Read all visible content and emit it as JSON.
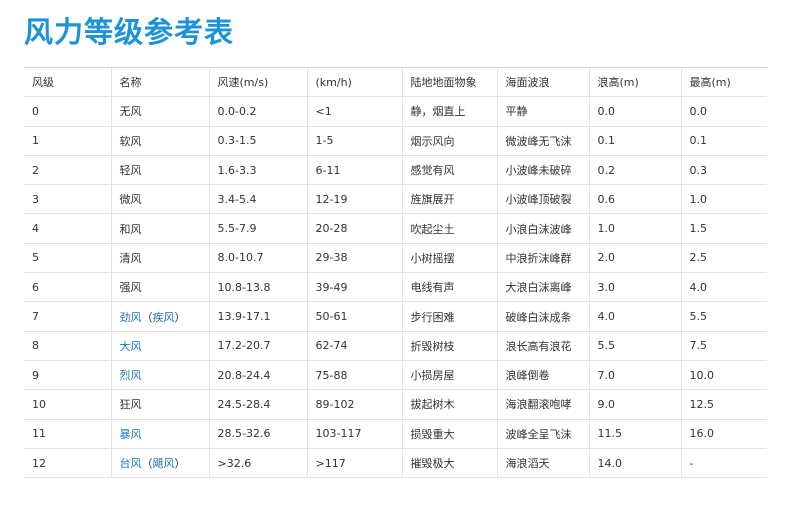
{
  "title": "风力等级参考表",
  "headers": [
    "风级",
    "名称",
    "风速(m/s)",
    "(km/h)",
    "陆地地面物象",
    "海面波浪",
    "浪高(m)",
    "最高(m)"
  ],
  "rows": [
    {
      "level": "0",
      "name": "无风",
      "alt": "",
      "ms": "0.0-0.2",
      "kmh": "<1",
      "land": "静，烟直上",
      "sea": "平静",
      "wave": "0.0",
      "max": "0.0"
    },
    {
      "level": "1",
      "name": "软风",
      "alt": "",
      "ms": "0.3-1.5",
      "kmh": "1-5",
      "land": "烟示风向",
      "sea": "微波峰无飞沫",
      "wave": "0.1",
      "max": "0.1"
    },
    {
      "level": "2",
      "name": "轻风",
      "alt": "",
      "ms": "1.6-3.3",
      "kmh": "6-11",
      "land": "感觉有风",
      "sea": "小波峰未破碎",
      "wave": "0.2",
      "max": "0.3"
    },
    {
      "level": "3",
      "name": "微风",
      "alt": "",
      "ms": "3.4-5.4",
      "kmh": "12-19",
      "land": "旌旗展开",
      "sea": "小波峰顶破裂",
      "wave": "0.6",
      "max": "1.0"
    },
    {
      "level": "4",
      "name": "和风",
      "alt": "",
      "ms": "5.5-7.9",
      "kmh": "20-28",
      "land": "吹起尘土",
      "sea": "小浪白沫波峰",
      "wave": "1.0",
      "max": "1.5"
    },
    {
      "level": "5",
      "name": "清风",
      "alt": "",
      "ms": "8.0-10.7",
      "kmh": "29-38",
      "land": "小树摇摆",
      "sea": "中浪折沫峰群",
      "wave": "2.0",
      "max": "2.5"
    },
    {
      "level": "6",
      "name": "强风",
      "alt": "",
      "ms": "10.8-13.8",
      "kmh": "39-49",
      "land": "电线有声",
      "sea": "大浪白沫离峰",
      "wave": "3.0",
      "max": "4.0"
    },
    {
      "level": "7",
      "name": "劲风",
      "alt": "疾风",
      "ms": "13.9-17.1",
      "kmh": "50-61",
      "land": "步行困难",
      "sea": "破峰白沫成条",
      "wave": "4.0",
      "max": "5.5"
    },
    {
      "level": "8",
      "name": "大风",
      "alt": "",
      "ms": "17.2-20.7",
      "kmh": "62-74",
      "land": "折毁树枝",
      "sea": "浪长高有浪花",
      "wave": "5.5",
      "max": "7.5"
    },
    {
      "level": "9",
      "name": "烈风",
      "alt": "",
      "ms": "20.8-24.4",
      "kmh": "75-88",
      "land": "小损房屋",
      "sea": "浪峰倒卷",
      "wave": "7.0",
      "max": "10.0"
    },
    {
      "level": "10",
      "name": "狂风",
      "alt": "",
      "ms": "24.5-28.4",
      "kmh": "89-102",
      "land": "拔起树木",
      "sea": "海浪翻滚咆哮",
      "wave": "9.0",
      "max": "12.5"
    },
    {
      "level": "11",
      "name": "暴风",
      "alt": "",
      "ms": "28.5-32.6",
      "kmh": "103-117",
      "land": "损毁重大",
      "sea": "波峰全呈飞沫",
      "wave": "11.5",
      "max": "16.0"
    },
    {
      "level": "12",
      "name": "台风",
      "alt": "飓风",
      "ms": ">32.6",
      "kmh": ">117",
      "land": "摧毁极大",
      "sea": "海浪滔天",
      "wave": "14.0",
      "max": "-"
    }
  ],
  "linked_levels": [
    "7",
    "8",
    "9",
    "11",
    "12"
  ],
  "colors": {
    "title": "#1a93d8",
    "link": "#1a73c0",
    "text": "#333333",
    "border": "#e2e2e2"
  }
}
